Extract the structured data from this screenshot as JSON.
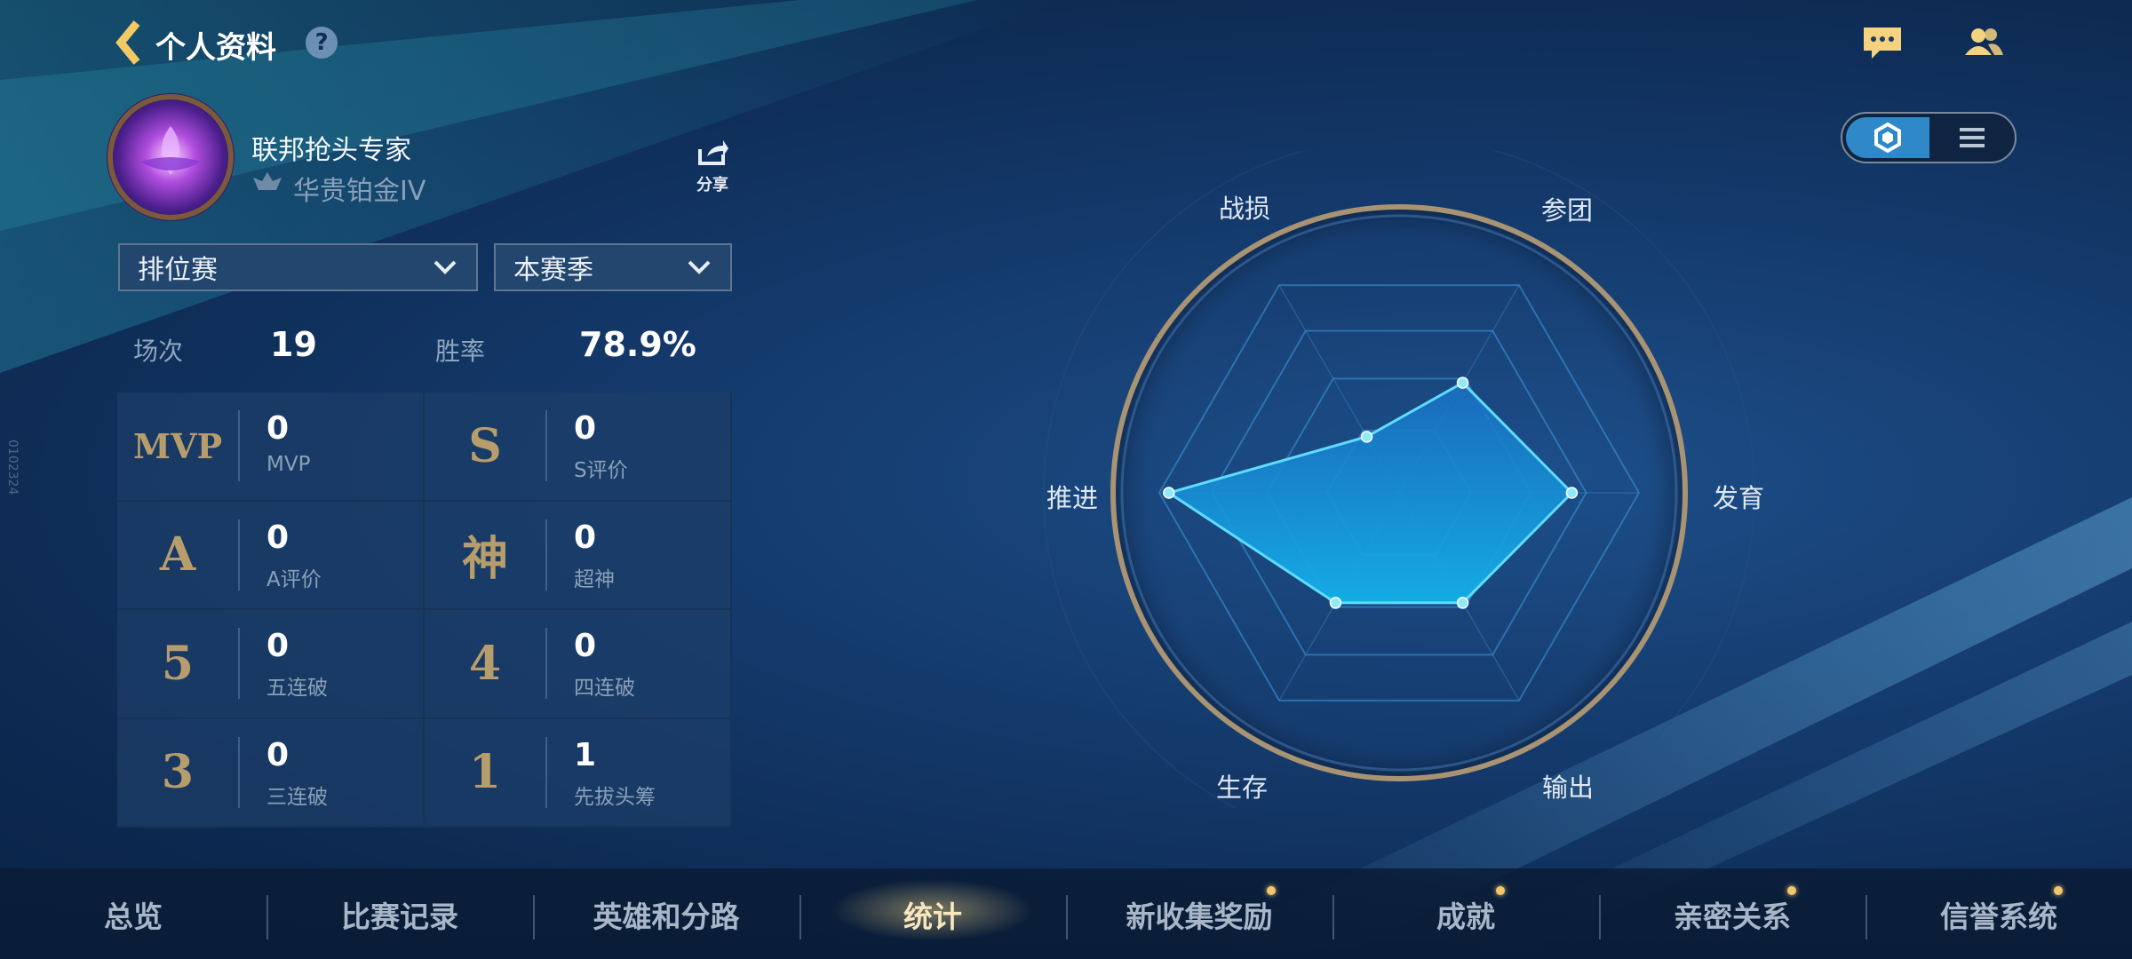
{
  "header": {
    "title": "个人资料",
    "help_glyph": "?"
  },
  "top_icons": [
    "chat-icon",
    "friends-icon"
  ],
  "profile": {
    "name": "联邦抢头专家",
    "rank": "华贵铂金IV",
    "share_label": "分享"
  },
  "filters": {
    "mode": "排位赛",
    "season": "本赛季"
  },
  "summary": {
    "matches_label": "场次",
    "matches_value": "19",
    "winrate_label": "胜率",
    "winrate_value": "78.9%"
  },
  "stats": [
    {
      "glyph": "MVP",
      "value": "0",
      "label": "MVP"
    },
    {
      "glyph": "S",
      "value": "0",
      "label": "S评价"
    },
    {
      "glyph": "A",
      "value": "0",
      "label": "A评价"
    },
    {
      "glyph": "神",
      "value": "0",
      "label": "超神"
    },
    {
      "glyph": "5",
      "value": "0",
      "label": "五连破"
    },
    {
      "glyph": "4",
      "value": "0",
      "label": "四连破"
    },
    {
      "glyph": "3",
      "value": "0",
      "label": "三连破"
    },
    {
      "glyph": "1",
      "value": "1",
      "label": "先拔头筹"
    }
  ],
  "radar": {
    "axes": [
      "战损",
      "参团",
      "发育",
      "输出",
      "生存",
      "推进"
    ],
    "values": [
      0.27,
      0.53,
      0.72,
      0.53,
      0.53,
      0.96
    ]
  },
  "view_toggle": {
    "selected": "hexagon-view",
    "options": [
      "hexagon-view",
      "list-view"
    ]
  },
  "tabs": [
    {
      "label": "总览",
      "dot": false
    },
    {
      "label": "比赛记录",
      "dot": false
    },
    {
      "label": "英雄和分路",
      "dot": false
    },
    {
      "label": "统计",
      "dot": false,
      "active": true
    },
    {
      "label": "新收集奖励",
      "dot": true
    },
    {
      "label": "成就",
      "dot": true
    },
    {
      "label": "亲密关系",
      "dot": true
    },
    {
      "label": "信誉系统",
      "dot": true
    }
  ],
  "side_id": "0102324"
}
